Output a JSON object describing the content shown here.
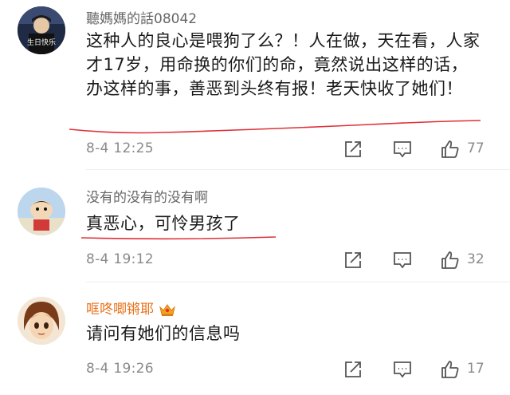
{
  "comments": [
    {
      "username": "聽媽媽的話08042",
      "avatar": "avatar-birthday",
      "avatar_text": "生日快乐",
      "text": "这种人的良心是喂狗了么？！人在做，天在看，人家才17岁，用命换的你们的命，竟然说出这样的话，办这样的事，善恶到头终有报！老天快收了她们！",
      "date": "8-4 12:25",
      "likes": "77"
    },
    {
      "username": "没有的没有的没有啊",
      "avatar": "avatar-cartoon",
      "text": "真恶心，可怜男孩了",
      "date": "8-4 19:12",
      "likes": "32"
    },
    {
      "username": "哐咚唧锵耶",
      "avatar": "avatar-anime",
      "text": "请问有她们的信息吗",
      "date": "8-4 19:26",
      "likes": "17"
    }
  ],
  "colors": {
    "username_gray": "#666666",
    "username_vip": "#e8701a",
    "underline": "#e0303a",
    "meta": "#8a8a8a"
  },
  "icons": [
    "share-icon",
    "comment-icon",
    "like-icon",
    "vip-crown-icon"
  ]
}
